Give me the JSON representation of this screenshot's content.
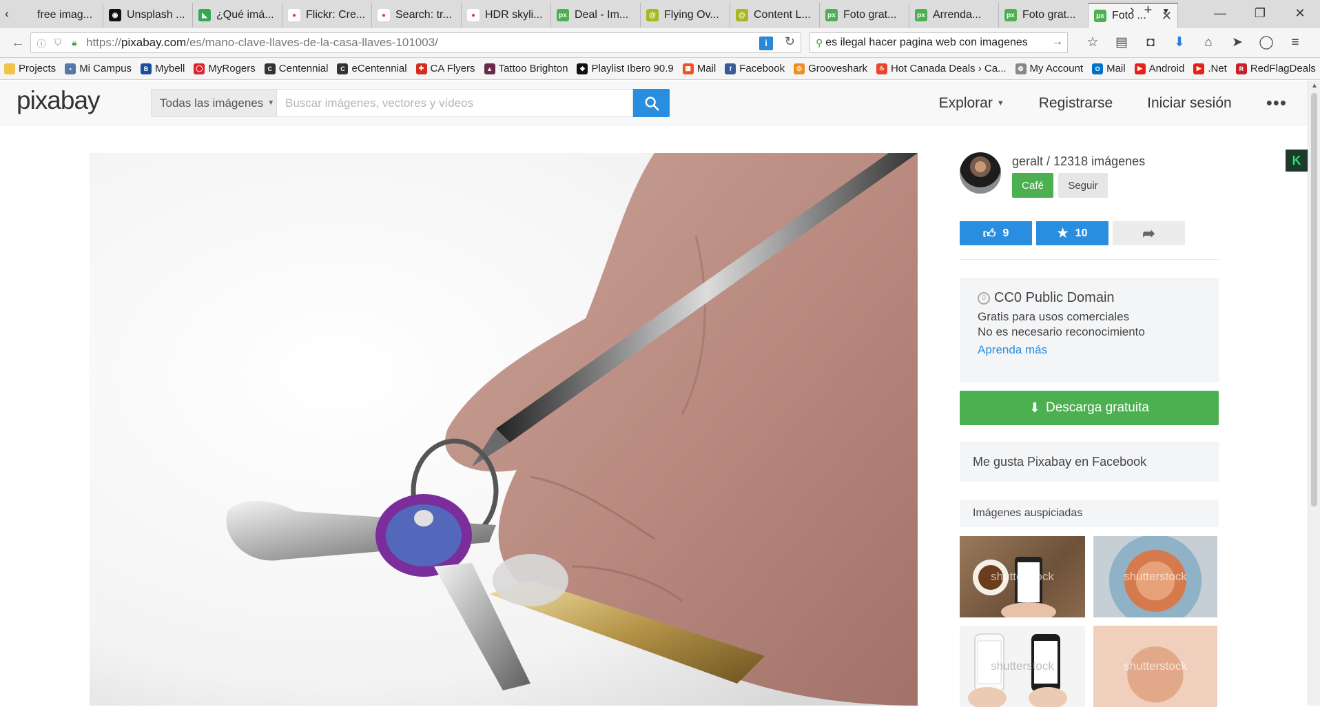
{
  "browser": {
    "tabs": [
      {
        "label": "free imag...",
        "icon": "blank-page-icon",
        "color": "#dcdcdc",
        "glyph": ""
      },
      {
        "label": "Unsplash ...",
        "icon": "camera-icon",
        "color": "#111111",
        "glyph": "◉"
      },
      {
        "label": "¿Qué imá...",
        "icon": "adwords-icon",
        "color": "#34a853",
        "glyph": "◣"
      },
      {
        "label": "Flickr: Cre...",
        "icon": "flickr-icon",
        "color": "#ffffff",
        "glyph": "●"
      },
      {
        "label": "Search: tr...",
        "icon": "flickr-icon",
        "color": "#ffffff",
        "glyph": "●"
      },
      {
        "label": "HDR skyli...",
        "icon": "flickr-icon",
        "color": "#ffffff",
        "glyph": "●"
      },
      {
        "label": "Deal - Im...",
        "icon": "pixabay-icon",
        "color": "#4caf50",
        "glyph": "px"
      },
      {
        "label": "Flying Ov...",
        "icon": "spiral-icon",
        "color": "#a8b820",
        "glyph": "@"
      },
      {
        "label": "Content L...",
        "icon": "spiral-icon",
        "color": "#a8b820",
        "glyph": "@"
      },
      {
        "label": "Foto grat...",
        "icon": "pixabay-icon",
        "color": "#4caf50",
        "glyph": "px"
      },
      {
        "label": "Arrenda...",
        "icon": "pixabay-icon",
        "color": "#4caf50",
        "glyph": "px"
      },
      {
        "label": "Foto grat...",
        "icon": "pixabay-icon",
        "color": "#4caf50",
        "glyph": "px"
      },
      {
        "label": "Foto ...",
        "icon": "pixabay-icon",
        "color": "#4caf50",
        "glyph": "px",
        "active": true
      }
    ],
    "url_prefix": "https://",
    "url_domain": "pixabay.com",
    "url_path": "/es/mano-clave-llaves-de-la-casa-llaves-101003/",
    "search_text": "es ilegal hacer pagina web con imagenes",
    "bookmarks": [
      {
        "label": "Projects",
        "icon": "folder-icon",
        "color": "#f2c24c",
        "glyph": ""
      },
      {
        "label": "Mi Campus",
        "icon": "campus-icon",
        "color": "#5577aa",
        "glyph": "▪"
      },
      {
        "label": "Mybell",
        "icon": "bell-icon",
        "color": "#1a4fa0",
        "glyph": "B"
      },
      {
        "label": "MyRogers",
        "icon": "rogers-icon",
        "color": "#d8242c",
        "glyph": "◯"
      },
      {
        "label": "Centennial",
        "icon": "centennial-icon",
        "color": "#333333",
        "glyph": "C"
      },
      {
        "label": "eCentennial",
        "icon": "centennial-icon",
        "color": "#333333",
        "glyph": "C"
      },
      {
        "label": "CA Flyers",
        "icon": "flag-icon",
        "color": "#d52b1e",
        "glyph": "✚"
      },
      {
        "label": "Tattoo Brighton",
        "icon": "tattoo-icon",
        "color": "#6a2a4a",
        "glyph": "▲"
      },
      {
        "label": "Playlist Ibero 90.9",
        "icon": "radio-icon",
        "color": "#111111",
        "glyph": "◆"
      },
      {
        "label": "Mail",
        "icon": "windows-icon",
        "color": "#f25022",
        "glyph": "▦"
      },
      {
        "label": "Facebook",
        "icon": "facebook-icon",
        "color": "#3b5998",
        "glyph": "f"
      },
      {
        "label": "Grooveshark",
        "icon": "grooveshark-icon",
        "color": "#f38d1b",
        "glyph": "◎"
      },
      {
        "label": "Hot Canada Deals › Ca...",
        "icon": "flame-icon",
        "color": "#e8462c",
        "glyph": "♨"
      },
      {
        "label": "My Account",
        "icon": "globe-icon",
        "color": "#888888",
        "glyph": "◍"
      },
      {
        "label": "Mail",
        "icon": "outlook-icon",
        "color": "#0072c6",
        "glyph": "O"
      },
      {
        "label": "Android",
        "icon": "youtube-icon",
        "color": "#e62117",
        "glyph": "▶"
      },
      {
        "label": ".Net",
        "icon": "youtube-icon",
        "color": "#e62117",
        "glyph": "▶"
      },
      {
        "label": "RedFlagDeals",
        "icon": "redflag-icon",
        "color": "#c8202a",
        "glyph": "R"
      }
    ]
  },
  "header": {
    "logo": "pixabay",
    "search_type": "Todas las imágenes",
    "search_placeholder": "Buscar imágenes, vectores y vídeos",
    "nav": {
      "explore": "Explorar",
      "register": "Registrarse",
      "login": "Iniciar sesión",
      "more": "•••"
    }
  },
  "author": {
    "name": "geralt / 12318 imágenes",
    "cafe": "Café",
    "follow": "Seguir"
  },
  "actions": {
    "likes": "9",
    "favorites": "10"
  },
  "license": {
    "title": "CC0 Public Domain",
    "line1": "Gratis para usos comerciales",
    "line2": "No es necesario reconocimiento",
    "link": "Aprenda más"
  },
  "download": {
    "label": "Descarga gratuita"
  },
  "facebook": {
    "label": "Me gusta Pixabay en Facebook"
  },
  "sponsored": {
    "title": "Imágenes auspiciadas",
    "watermark": "shutterstock"
  },
  "colors": {
    "accent_blue": "#2a8ee0",
    "accent_green": "#4caf50"
  }
}
